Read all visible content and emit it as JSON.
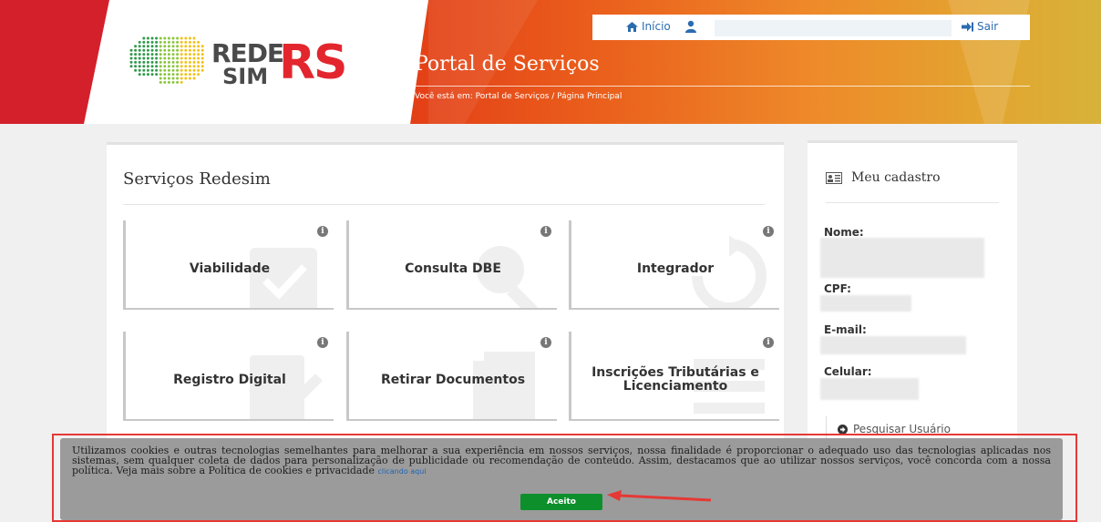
{
  "header": {
    "logo": {
      "line1": "REDE",
      "line2": "SIM",
      "state": "RS"
    },
    "nav": {
      "home_label": "Início",
      "user_name": "",
      "logout_label": "Sair"
    },
    "portal_title": "Portal de Serviços",
    "breadcrumb": "Você está em: Portal de Serviços / Página Principal"
  },
  "services": {
    "title": "Serviços Redesim",
    "tiles": [
      {
        "label": "Viabilidade",
        "icon": "calendar-check-icon"
      },
      {
        "label": "Consulta DBE",
        "icon": "document-search-icon"
      },
      {
        "label": "Integrador",
        "icon": "refresh-icon"
      },
      {
        "label": "Registro Digital",
        "icon": "edit-icon"
      },
      {
        "label": "Retirar Documentos",
        "icon": "documents-icon"
      },
      {
        "label": "Inscrições Tributárias e Licenciamento",
        "icon": "list-icon"
      }
    ],
    "info_glyph": "i"
  },
  "profile": {
    "title": "Meu cadastro",
    "fields": [
      {
        "label": "Nome:",
        "value": ""
      },
      {
        "label": "CPF:",
        "value": ""
      },
      {
        "label": "E-mail:",
        "value": ""
      },
      {
        "label": "Celular:",
        "value": ""
      }
    ],
    "search_user_label": "Pesquisar Usuário"
  },
  "cookie_banner": {
    "text": "Utilizamos cookies e outras tecnologias semelhantes para melhorar a sua experiência em nossos serviços, nossa finalidade é proporcionar o adequado uso das tecnologias aplicadas nos sistemas, sem qualquer coleta de dados para personalização de publicidade ou recomendação de conteúdo. Assim, destacamos que ao utilizar nossos serviços, você concorda com a nossa política. Veja mais sobre a Política de cookies e privacidade",
    "link_label": "clicando aqui",
    "accept_label": "Aceito"
  },
  "colors": {
    "brand_red": "#d4202b",
    "header_gradient_start": "#e23a16",
    "header_gradient_end": "#d7b23a",
    "link_blue": "#2b6cb0",
    "accept_green": "#0d8f2c",
    "annotation_red": "#e53935"
  }
}
